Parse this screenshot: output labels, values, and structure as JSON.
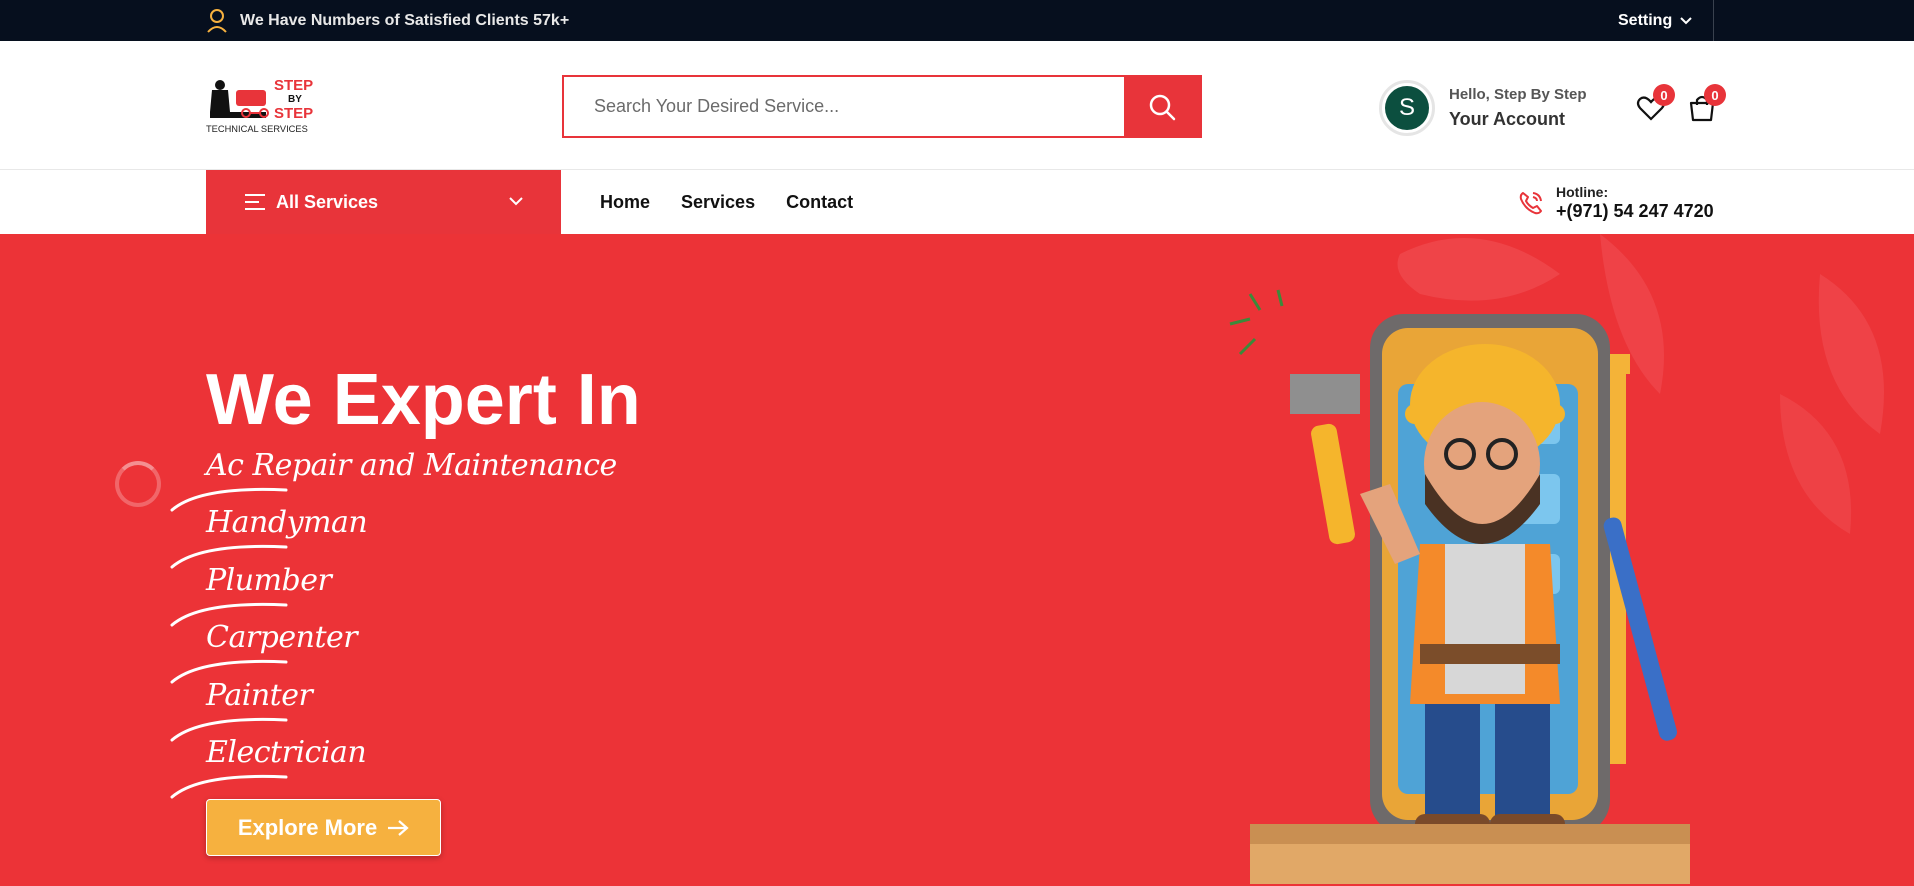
{
  "topbar": {
    "promo_text": "We Have Numbers of Satisfied Clients 57k+",
    "setting_label": "Setting"
  },
  "header": {
    "logo_line1": "STEP",
    "logo_line2": "BY",
    "logo_line3": "STEP",
    "logo_tagline": "TECHNICAL SERVICES",
    "search_placeholder": "Search Your Desired Service...",
    "account": {
      "avatar_letter": "S",
      "greeting": "Hello, Step By Step",
      "label": "Your Account"
    },
    "wishlist_count": "0",
    "cart_count": "0"
  },
  "nav": {
    "all_services_label": "All Services",
    "links": [
      "Home",
      "Services",
      "Contact"
    ],
    "hotline_label": "Hotline:",
    "hotline_number": "+(971) 54 247 4720"
  },
  "hero": {
    "heading": "We Expert In",
    "services": [
      "Ac Repair and Maintenance",
      "Handyman",
      "Plumber",
      "Carpenter",
      "Painter",
      "Electrician"
    ],
    "cta_label": "Explore More"
  },
  "colors": {
    "brand_red": "#ec3337",
    "topbar_bg": "#060f1e",
    "cta_orange": "#f6b13f",
    "avatar_green": "#0c4f3f"
  },
  "icons": [
    "user-icon",
    "chevron-down-icon",
    "search-icon",
    "heart-icon",
    "bag-icon",
    "menu-icon",
    "phone-icon",
    "arrow-right-icon"
  ]
}
